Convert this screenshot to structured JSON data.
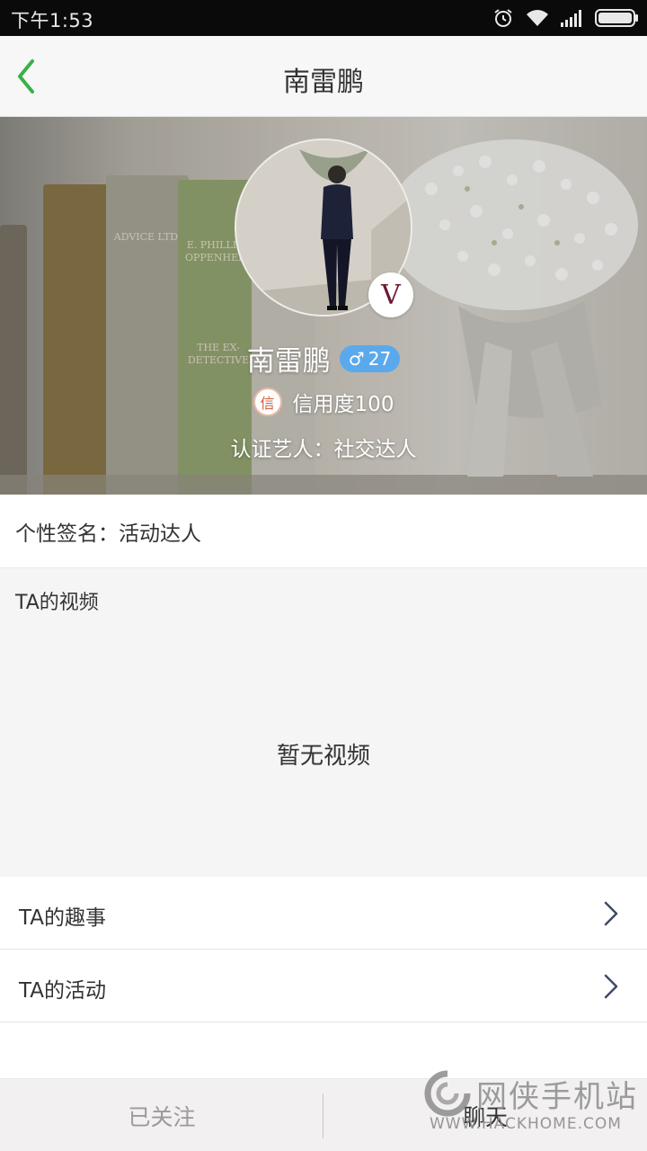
{
  "status_bar": {
    "time": "下午1:53",
    "icons": [
      "alarm-icon",
      "wifi-icon",
      "signal-icon",
      "battery-icon"
    ]
  },
  "nav": {
    "title": "南雷鹏",
    "back_icon": "chevron-left-icon"
  },
  "profile": {
    "name": "南雷鹏",
    "gender_symbol": "♂",
    "age": "27",
    "credit_icon_glyph": "信",
    "credit_text": "信用度100",
    "certification": "认证艺人：社交达人",
    "verified_badge": "V",
    "book_titles": [
      "ADVICE LTD.",
      "E. PHILLIPS OPPENHEIM",
      "THE EX-DETECTIVE"
    ]
  },
  "signature": {
    "text": "个性签名：活动达人"
  },
  "videos": {
    "title": "TA的视频",
    "empty_text": "暂无视频"
  },
  "list": [
    {
      "label": "TA的趣事"
    },
    {
      "label": "TA的活动"
    }
  ],
  "bottom": {
    "followed_label": "已关注",
    "chat_label": "聊天"
  },
  "watermark": {
    "text": "网侠手机站",
    "url": "WWW.HACKHOME.COM"
  },
  "colors": {
    "accent_green": "#3bb04a",
    "gender_badge": "#5aa9ec"
  }
}
